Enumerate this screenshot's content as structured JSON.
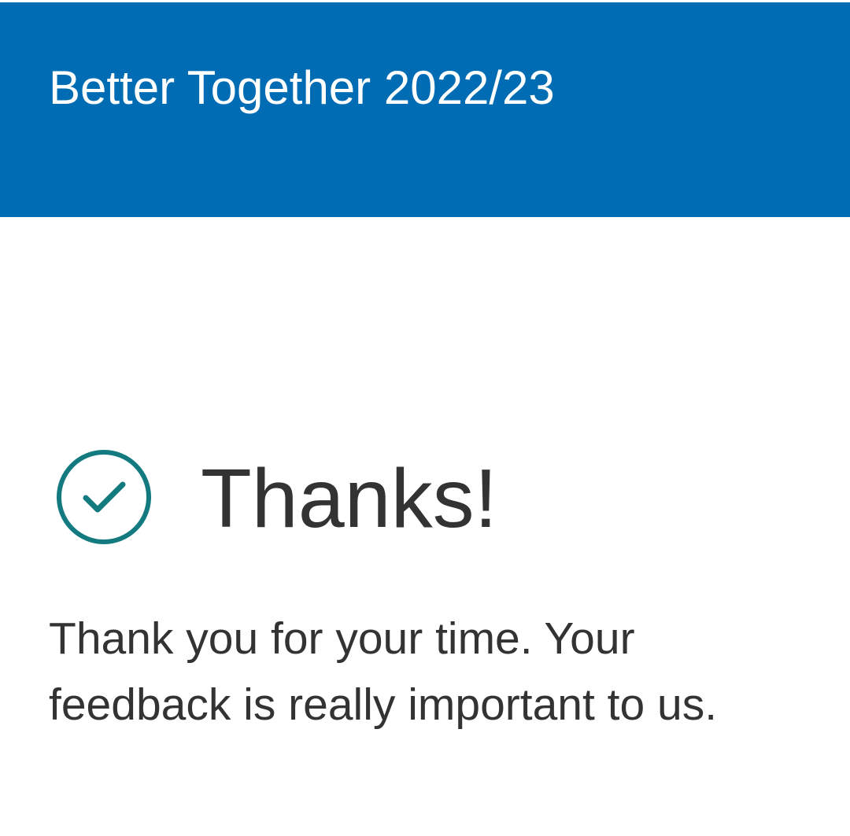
{
  "header": {
    "title": "Better Together 2022/23",
    "background_color": "#006cb4"
  },
  "confirmation": {
    "icon": "check-circle-icon",
    "icon_color": "#137a80",
    "heading": "Thanks!",
    "message": "Thank you for your time. Your feedback is really important to us."
  }
}
